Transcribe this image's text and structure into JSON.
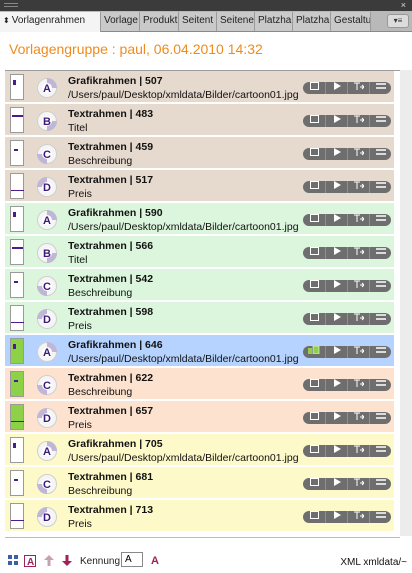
{
  "panel": {
    "close_glyph": "×",
    "tabs": [
      {
        "label": "Vorlagenrahmen",
        "active": true
      },
      {
        "label": "Vorlage",
        "active": false
      },
      {
        "label": "Produkt",
        "active": false
      },
      {
        "label": "Seitent",
        "active": false
      },
      {
        "label": "Seitene",
        "active": false
      },
      {
        "label": "Platzha",
        "active": false
      },
      {
        "label": "Platzha",
        "active": false
      },
      {
        "label": "Gestaltu",
        "active": false
      }
    ],
    "tab_arrows": "⬍",
    "tab_menu_glyph": "▾≡"
  },
  "group_title": "Vorlagengruppe : paul, 06.04.2010 14:32",
  "colors": {
    "accent": "#ef8b1c",
    "row_tan": "#e6d9ce",
    "row_green": "#dbf6dd",
    "row_selected": "#b6d3ff",
    "row_peach": "#fde3cf",
    "row_yellow": "#fdf9c9",
    "mark": "#4b1a8c"
  },
  "rows": [
    {
      "title": "Grafikrahmen | 507",
      "sub": "/Users/paul/Desktop/xmldata/Bilder/cartoon01.jpg",
      "letter": "A",
      "group": "tan"
    },
    {
      "title": "Textrahmen | 483",
      "sub": "Titel",
      "letter": "B",
      "group": "tan"
    },
    {
      "title": "Textrahmen | 459",
      "sub": "Beschreibung",
      "letter": "C",
      "group": "tan"
    },
    {
      "title": "Textrahmen | 517",
      "sub": "Preis",
      "letter": "D",
      "group": "tan"
    },
    {
      "title": "Grafikrahmen | 590",
      "sub": "/Users/paul/Desktop/xmldata/Bilder/cartoon01.jpg",
      "letter": "A",
      "group": "green"
    },
    {
      "title": "Textrahmen | 566",
      "sub": "Titel",
      "letter": "B",
      "group": "green"
    },
    {
      "title": "Textrahmen | 542",
      "sub": "Beschreibung",
      "letter": "C",
      "group": "green"
    },
    {
      "title": "Textrahmen | 598",
      "sub": "Preis",
      "letter": "D",
      "group": "green"
    },
    {
      "title": "Grafikrahmen | 646",
      "sub": "/Users/paul/Desktop/xmldata/Bilder/cartoon01.jpg",
      "letter": "A",
      "group": "selected"
    },
    {
      "title": "Textrahmen | 622",
      "sub": "Beschreibung",
      "letter": "C",
      "group": "peach"
    },
    {
      "title": "Textrahmen | 657",
      "sub": "Preis",
      "letter": "D",
      "group": "peach"
    },
    {
      "title": "Grafikrahmen | 705",
      "sub": "/Users/paul/Desktop/xmldata/Bilder/cartoon01.jpg",
      "letter": "A",
      "group": "yellow"
    },
    {
      "title": "Textrahmen | 681",
      "sub": "Beschreibung",
      "letter": "C",
      "group": "yellow"
    },
    {
      "title": "Textrahmen | 713",
      "sub": "Preis",
      "letter": "D",
      "group": "yellow"
    }
  ],
  "row_actions": [
    "view-icon",
    "play-icon",
    "place-icon",
    "list-icon"
  ],
  "bottom": {
    "kennung_label": "Kennung",
    "kennung_value": "A",
    "letter_button": "A",
    "xml_path": "XML xmldata/~"
  }
}
